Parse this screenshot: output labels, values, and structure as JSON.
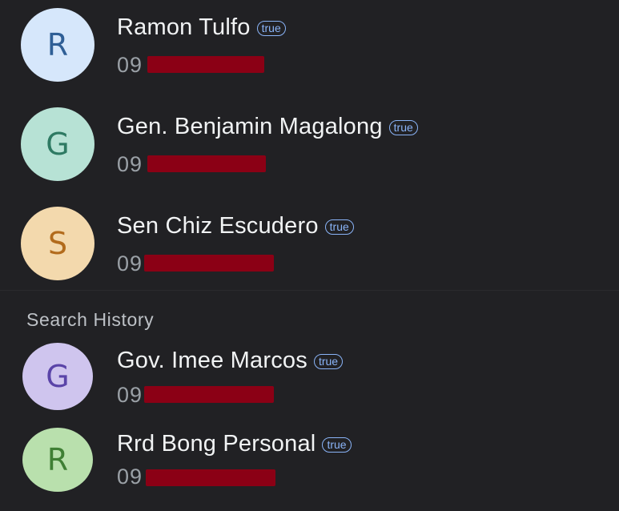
{
  "contacts": [
    {
      "initial": "R",
      "name": "Ramon Tulfo",
      "badge": "true",
      "phone_visible": "09",
      "avatar_bg": "#d6e7fb",
      "avatar_fg": "#2f5f96"
    },
    {
      "initial": "G",
      "name": "Gen. Benjamin Magalong",
      "badge": "true",
      "phone_visible": "09",
      "avatar_bg": "#b7e2d5",
      "avatar_fg": "#2e7a63"
    },
    {
      "initial": "S",
      "name": "Sen Chiz Escudero",
      "badge": "true",
      "phone_visible": "09",
      "avatar_bg": "#f3d9ad",
      "avatar_fg": "#b26b1c"
    }
  ],
  "search_history": {
    "header": "Search History",
    "contacts": [
      {
        "initial": "G",
        "name": "Gov. Imee Marcos",
        "badge": "true",
        "phone_visible": "09",
        "avatar_bg": "#cfc5ee",
        "avatar_fg": "#5a44a8"
      },
      {
        "initial": "R",
        "name": "Rrd Bong Personal",
        "badge": "true",
        "phone_visible": "09",
        "avatar_bg": "#b9e0ad",
        "avatar_fg": "#3f7f34"
      }
    ]
  },
  "colors": {
    "background": "#212124",
    "badge": "#8ab4f8",
    "redaction": "#8b0015"
  }
}
